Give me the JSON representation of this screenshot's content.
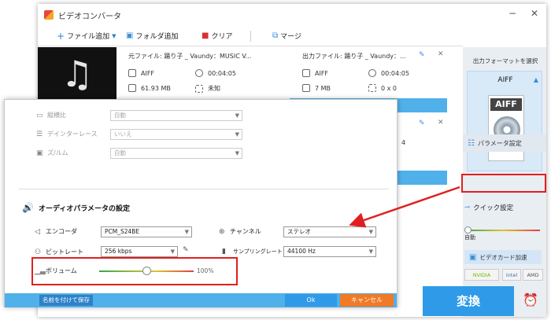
{
  "app": {
    "title": "ビデオコンバータ",
    "minimize": "−",
    "close": "✕"
  },
  "toolbar": {
    "add_file": "ファイル追加",
    "add_folder": "フォルダ追加",
    "clear": "クリア",
    "merge": "マージ"
  },
  "file_item": {
    "source_label": "元ファイル: 踊り子 _ Vaundy：MUSIC V...",
    "source_format": "AIFF",
    "source_duration": "00:04:05",
    "source_size": "61.93 MB",
    "source_resolution": "未知",
    "output_label": "出力ファイル: 踊り子 _ Vaundy：...",
    "output_format": "AIFF",
    "output_duration": "00:04:05",
    "output_size": "7 MB",
    "output_resolution": "0 x 0",
    "partial_digit": "4"
  },
  "right_panel": {
    "output_format_label": "出力フォーマットを選択",
    "format_name": "AIFF",
    "format_badge": "AIFF",
    "param_settings": "パラメータ設定",
    "quick_settings": "クイック設定",
    "auto_label": "自動",
    "gpu_accel": "ビデオカード加速",
    "nvidia": "NVIDIA",
    "intel": "intel",
    "amd": "AMD",
    "convert": "変換"
  },
  "dialog": {
    "video": {
      "aspect_label": "縦横比",
      "aspect_value": "自動",
      "deinterlace_label": "デインターレース",
      "deinterlace_value": "いいえ",
      "zoom_label": "ズ/ルム",
      "zoom_value": "自動"
    },
    "audio_section_title": "オーディオパラメータの設定",
    "encoder_label": "エンコーダ",
    "encoder_value": "PCM_S24BE",
    "channel_label": "チャンネル",
    "channel_value": "ステレオ",
    "bitrate_label": "ビットレート",
    "bitrate_value": "256 kbps",
    "samplerate_label": "サンプリングレート",
    "samplerate_value": "44100 Hz",
    "volume_label": "ボリューム",
    "volume_percent": "100%",
    "volume_level": 0.5,
    "save_as": "名前を付けて保存",
    "ok": "Ok",
    "cancel": "キャンセル"
  },
  "colors": {
    "accent": "#2f9be8",
    "highlight": "#e02020",
    "cancel": "#f07a26"
  }
}
